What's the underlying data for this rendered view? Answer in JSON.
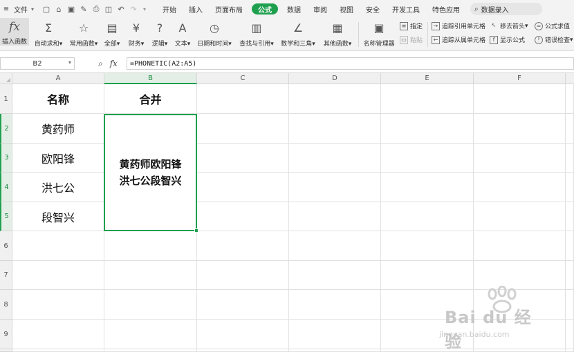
{
  "menu": {
    "file_label": "文件",
    "tabs": [
      "开始",
      "插入",
      "页面布局",
      "公式",
      "数据",
      "审阅",
      "视图",
      "安全",
      "开发工具",
      "特色应用"
    ],
    "active_tab": "公式",
    "search_placeholder": "数据录入"
  },
  "ribbon": {
    "insert_function": "插入函数",
    "autosum": "自动求和",
    "common_functions": "常用函数",
    "all": "全部",
    "finance": "财务",
    "logic": "逻辑",
    "text": "文本",
    "datetime": "日期和时间",
    "lookup": "查找与引用",
    "math": "数学和三角",
    "other": "其他函数",
    "name_manager": "名称管理器",
    "specify": "指定",
    "paste": "粘贴",
    "trace_precedents": "追踪引用单元格",
    "trace_dependents": "追踪从属单元格",
    "remove_arrows": "移去箭头",
    "show_formulas": "显示公式",
    "evaluate_formula": "公式求值",
    "error_checking": "错误检查"
  },
  "formula_bar": {
    "name_box": "B2",
    "fx_label": "fx",
    "formula": "=PHONETIC(A2:A5)"
  },
  "sheet": {
    "columns": [
      "A",
      "B",
      "C",
      "D",
      "E",
      "F"
    ],
    "active_column": "B",
    "rows": [
      "1",
      "2",
      "3",
      "4",
      "5",
      "6",
      "7",
      "8",
      "9"
    ],
    "headers": {
      "A1": "名称",
      "B1": "合并"
    },
    "names": [
      "黄药师",
      "欧阳锋",
      "洪七公",
      "段智兴"
    ],
    "merged_result_line1": "黄药师欧阳锋",
    "merged_result_line2": "洪七公段智兴"
  },
  "watermark": {
    "brand": "Bai du 经验",
    "url": "jingyan.baidu.com"
  },
  "colors": {
    "accent": "#1fa04f",
    "header_bg": "#f0f0f0"
  }
}
